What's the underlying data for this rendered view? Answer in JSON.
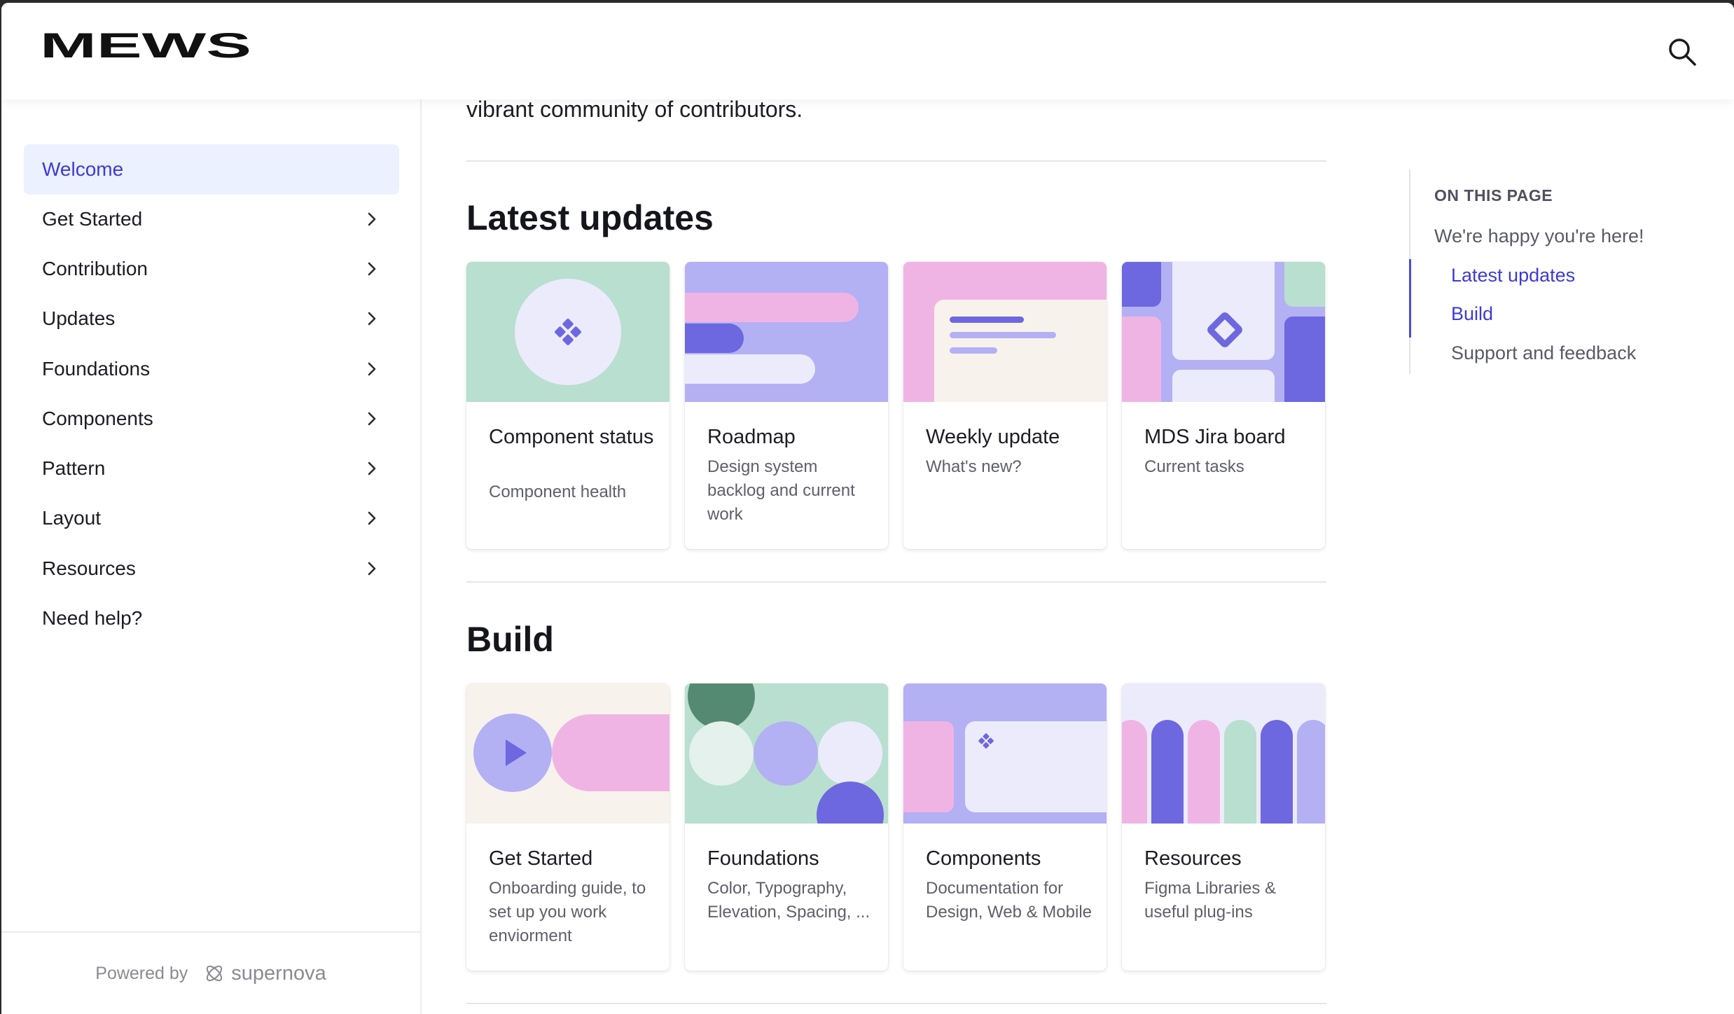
{
  "brand": {
    "logo_text": "MEWS"
  },
  "sidebar": {
    "items": [
      {
        "label": "Welcome",
        "active": true,
        "has_children": false
      },
      {
        "label": "Get Started",
        "has_children": true
      },
      {
        "label": "Contribution",
        "has_children": true
      },
      {
        "label": "Updates",
        "has_children": true
      },
      {
        "label": "Foundations",
        "has_children": true
      },
      {
        "label": "Components",
        "has_children": true
      },
      {
        "label": "Pattern",
        "has_children": true
      },
      {
        "label": "Layout",
        "has_children": true
      },
      {
        "label": "Resources",
        "has_children": true
      },
      {
        "label": "Need help?",
        "has_children": false
      }
    ],
    "footer": {
      "powered_by": "Powered by",
      "brand": "supernova"
    }
  },
  "main": {
    "intro_tail": "vibrant community of contributors.",
    "sections": [
      {
        "heading": "Latest updates",
        "cards": [
          {
            "title": "Component status",
            "description": "Component health"
          },
          {
            "title": "Roadmap",
            "description": "Design system backlog and current work"
          },
          {
            "title": "Weekly update",
            "description": "What's new?"
          },
          {
            "title": "MDS Jira board",
            "description": "Current tasks"
          }
        ]
      },
      {
        "heading": "Build",
        "cards": [
          {
            "title": "Get Started",
            "description": "Onboarding guide, to set up you work enviorment"
          },
          {
            "title": "Foundations",
            "description": "Color, Typography, Elevation, Spacing, ..."
          },
          {
            "title": "Components",
            "description": "Documentation for Design, Web & Mobile"
          },
          {
            "title": "Resources",
            "description": "Figma Libraries & useful plug-ins"
          }
        ]
      }
    ]
  },
  "toc": {
    "heading": "ON THIS PAGE",
    "items": [
      {
        "label": "We're happy you're here!",
        "level": 1
      },
      {
        "label": "Latest updates",
        "level": 2,
        "current": true
      },
      {
        "label": "Build",
        "level": 2,
        "current": true
      },
      {
        "label": "Support and feedback",
        "level": 2
      }
    ]
  },
  "colors": {
    "accent": "#3e3ad6",
    "active_bg": "#ebf1fe",
    "mint": "#b8dfcf",
    "lavender": "#b3b0f4",
    "pink": "#f0b4e4",
    "indigo": "#6d67e0",
    "cream": "#f7f2ec",
    "pale": "#ecebfb"
  },
  "icons": [
    "search-icon",
    "chevron-right-icon",
    "supernova-logo-icon",
    "play-icon",
    "diamond-icon"
  ]
}
